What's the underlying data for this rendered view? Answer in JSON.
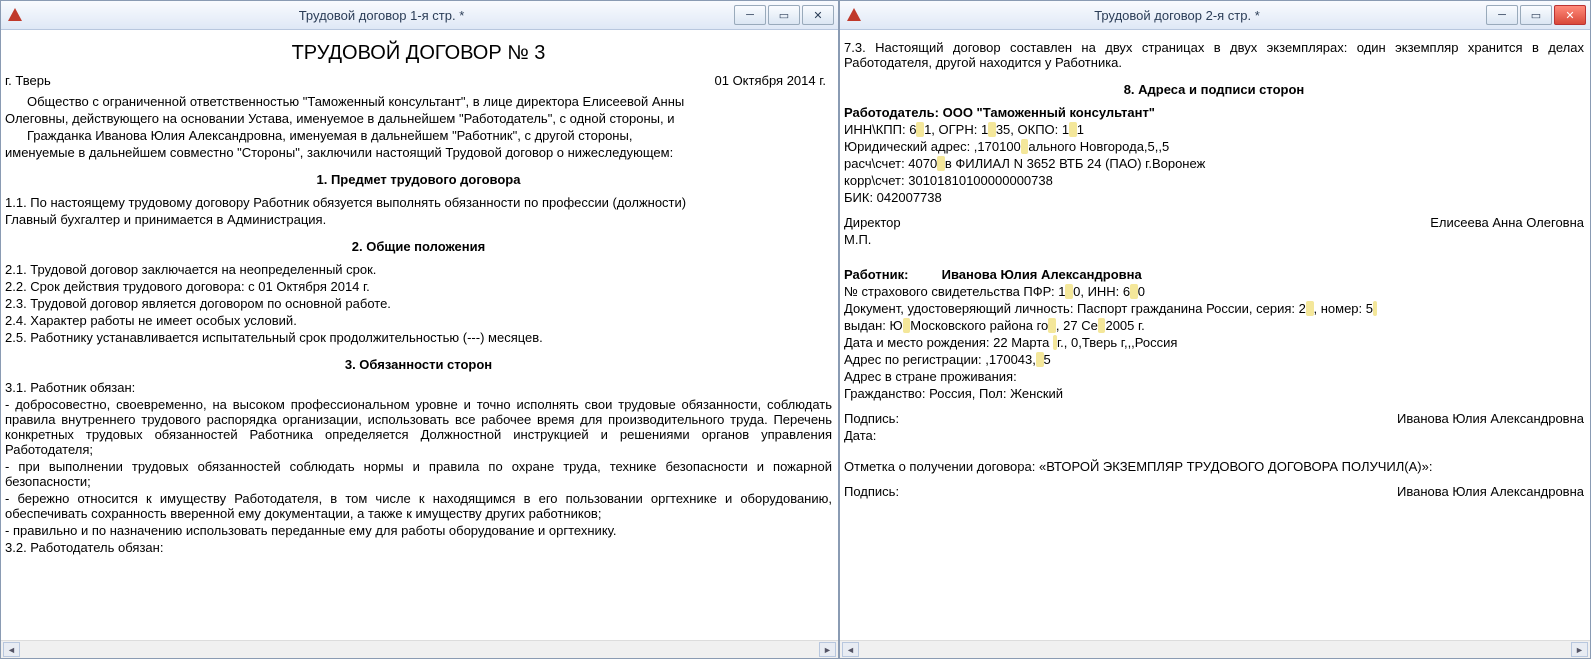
{
  "left": {
    "title": "Трудовой договор 1-я стр. *",
    "doc_title": "ТРУДОВОЙ ДОГОВОР № 3",
    "city": "г. Тверь",
    "date": "01 Октября 2014 г.",
    "preamble_l1": "Общество с ограниченной ответственностью \"Таможенный консультант\", в лице директора Елисеевой Анны",
    "preamble_l2": "Олеговны, действующего на основании Устава, именуемое в дальнейшем \"Работодатель\", с одной стороны, и",
    "preamble_l3": "Гражданка Иванова Юлия Александровна, именуемая в дальнейшем \"Работник\", с другой стороны,",
    "preamble_l4": "именуемые в дальнейшем совместно \"Стороны\", заключили настоящий Трудовой договор о нижеследующем:",
    "sec1": "1. Предмет трудового договора",
    "p11a": "1.1. По настоящему трудовому договору Работник обязуется выполнять обязанности по профессии (должности)",
    "p11b": "Главный бухгалтер и принимается в Администрация.",
    "sec2": "2. Общие положения",
    "p21": "2.1. Трудовой договор заключается на неопределенный срок.",
    "p22": "2.2. Срок действия трудового договора: с 01 Октября 2014 г.",
    "p23": "2.3. Трудовой договор является договором по основной работе.",
    "p24": "2.4. Характер работы не имеет особых условий.",
    "p25": "2.5. Работнику устанавливается испытательный срок продолжительностью (---)  месяцев.",
    "sec3": "3. Обязанности сторон",
    "p31": "3.1. Работник обязан:",
    "p31a": "- добросовестно, своевременно, на высоком профессиональном уровне и точно исполнять свои трудовые обязанности, соблюдать правила внутреннего трудового распорядка  организации, использовать все рабочее время для производительного труда. Перечень конкретных трудовых обязанностей Работника определяется Должностной инструкцией и решениями органов управления Работодателя;",
    "p31b": "- при  выполнении трудовых обязанностей соблюдать нормы и правила по охране труда, технике безопасности и пожарной безопасности;",
    "p31c": "- бережно  относится к имуществу Работодателя, в том числе к находящимся в его пользовании оргтехнике и оборудованию, обеспечивать сохранность вверенной  ему  документации, а также к имуществу других работников;",
    "p31d": "- правильно и по назначению использовать переданные ему для работы оборудование и оргтехнику.",
    "p32": "3.2. Работодатель обязан:"
  },
  "right": {
    "title": "Трудовой договор 2-я стр. *",
    "p73": "7.3. Настоящий договор составлен на двух страницах в двух экземплярах: один экземпляр хранится в делах Работодателя, другой находится у Работника.",
    "sec8": "8. Адреса и подписи сторон",
    "emp_head": "Работодатель: ООО \"Таможенный консультант\"",
    "inn_pre": "ИНН\\КПП: 6",
    "inn_mask": "                        ",
    "ogrn_pre": "1, ОГРН: 1",
    "ogrn_mask": "             ",
    "okpo_pre": "35, ОКПО: 1",
    "okpo_mask": "       ",
    "okpo_end": "1",
    "jaddr_pre": "Юридический адрес: ,170100",
    "jaddr_mask": "                                           ",
    "jaddr_end": "ального Новгорода,5,,5",
    "rs_pre": "расч\\счет: 4070",
    "rs_mask": "                       ",
    "rs_end": " в ФИЛИАЛ N 3652 ВТБ 24 (ПАО) г.Воронеж",
    "ks": "корр\\счет: 30101810100000000738",
    "bik": "БИК: 042007738",
    "director_lbl": "Директор",
    "director_name": "Елисеева Анна Олеговна",
    "mp": "М.П.",
    "wk_lbl": "Работник:",
    "wk_name": "Иванова Юлия Александровна",
    "pfr_pre": "№ страхового свидетельства ПФР: 1",
    "pfr_mask": "                     ",
    "pfr_mid": "0, ИНН: 6",
    "pfr_mask2": "               ",
    "pfr_end": "0",
    "docid_pre": "Документ, удостоверяющий личность: Паспорт гражданина России, серия: 2",
    "docid_mask": "    ",
    "docid_mid": ", номер: 5",
    "docid_mask2": "        ",
    "issued_pre": "выдан: Ю",
    "issued_mask": "                                    ",
    "issued_mid": " Московского района го",
    "issued_mask2": "                ",
    "issued_mid2": ", 27 Се",
    "issued_mask3": "      ",
    "issued_end": " 2005 г.",
    "birth_pre": "Дата и место рождения: 22 Марта ",
    "birth_mask": "     ",
    "birth_end": " г., 0,Тверь г,,,Россия",
    "reg_pre": "Адрес по регистрации: ,170043,",
    "reg_mask": "                                              ",
    "reg_end": "5",
    "liveaddr": "Адрес в стране проживания:",
    "citizen": "Гражданство: Россия, Пол: Женский",
    "sig_lbl": "Подпись:",
    "sig_name": "Иванова Юлия Александровна",
    "date_lbl": "Дата:",
    "receipt": "Отметка о получении договора: «ВТОРОЙ ЭКЗЕМПЛЯР ТРУДОВОГО ДОГОВОРА ПОЛУЧИЛ(А)»:",
    "sig2_lbl": "Подпись:",
    "sig2_name": "Иванова Юлия Александровна"
  }
}
